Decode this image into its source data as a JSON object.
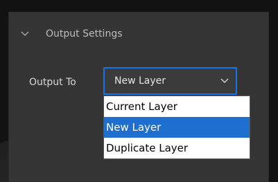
{
  "section": {
    "title": "Output Settings",
    "expanded": true,
    "icon": "chevron-down-icon"
  },
  "output": {
    "label": "Output To",
    "selected": "New Layer",
    "options": [
      "Current Layer",
      "New Layer",
      "Duplicate Layer"
    ],
    "highlighted_index": 1
  },
  "colors": {
    "accent": "#1473e6",
    "highlight": "#1f6fcf",
    "panel_bg": "#353535"
  }
}
